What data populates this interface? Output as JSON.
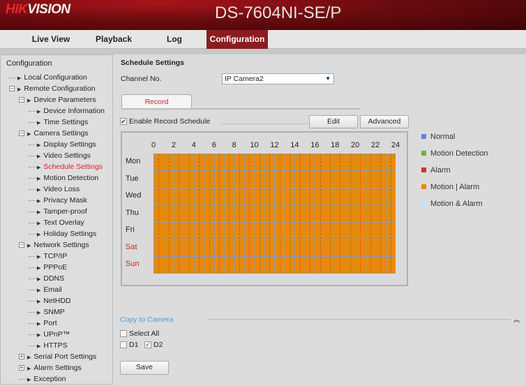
{
  "header": {
    "logo": "HIKVISION",
    "model": "DS-7604NI-SE/P"
  },
  "nav": [
    {
      "label": "Live View"
    },
    {
      "label": "Playback"
    },
    {
      "label": "Log"
    },
    {
      "label": "Configuration",
      "active": true
    }
  ],
  "sidebar": {
    "title": "Configuration",
    "items": [
      {
        "label": "Local Configuration",
        "level": 0
      },
      {
        "label": "Remote Configuration",
        "level": 0,
        "expanded": true
      },
      {
        "label": "Device Parameters",
        "level": 1,
        "expanded": true
      },
      {
        "label": "Device Information",
        "level": 2
      },
      {
        "label": "Time Settings",
        "level": 2
      },
      {
        "label": "Camera Settings",
        "level": 1,
        "expanded": true
      },
      {
        "label": "Display Settings",
        "level": 2
      },
      {
        "label": "Video Settings",
        "level": 2
      },
      {
        "label": "Schedule Settings",
        "level": 2,
        "selected": true
      },
      {
        "label": "Motion Detection",
        "level": 2
      },
      {
        "label": "Video Loss",
        "level": 2
      },
      {
        "label": "Privacy Mask",
        "level": 2
      },
      {
        "label": "Tamper-proof",
        "level": 2
      },
      {
        "label": "Text Overlay",
        "level": 2
      },
      {
        "label": "Holiday Settings",
        "level": 2
      },
      {
        "label": "Network Settings",
        "level": 1,
        "expanded": true
      },
      {
        "label": "TCP/IP",
        "level": 2
      },
      {
        "label": "PPPoE",
        "level": 2
      },
      {
        "label": "DDNS",
        "level": 2
      },
      {
        "label": "Email",
        "level": 2
      },
      {
        "label": "NetHDD",
        "level": 2
      },
      {
        "label": "SNMP",
        "level": 2
      },
      {
        "label": "Port",
        "level": 2
      },
      {
        "label": "UPnP™",
        "level": 2
      },
      {
        "label": "HTTPS",
        "level": 2
      },
      {
        "label": "Serial Port Settings",
        "level": 1,
        "collapsed": true
      },
      {
        "label": "Alarm Settings",
        "level": 1,
        "collapsed": true
      },
      {
        "label": "Exception",
        "level": 1
      }
    ]
  },
  "main": {
    "title": "Schedule Settings",
    "channel_label": "Channel No.",
    "channel_value": "IP Camera2",
    "tab": "Record",
    "enable_label": "Enable Record Schedule",
    "enable_checked": true,
    "edit": "Edit",
    "advanced": "Advanced",
    "hours": [
      "0",
      "2",
      "4",
      "6",
      "8",
      "10",
      "12",
      "14",
      "16",
      "18",
      "20",
      "22",
      "24"
    ],
    "days": [
      {
        "label": "Mon"
      },
      {
        "label": "Tue"
      },
      {
        "label": "Wed"
      },
      {
        "label": "Thu"
      },
      {
        "label": "Fri"
      },
      {
        "label": "Sat",
        "weekend": true
      },
      {
        "label": "Sun",
        "weekend": true
      }
    ],
    "schedule_fill": "Motion | Alarm, all days 00:00-24:00",
    "legend": [
      {
        "label": "Normal",
        "color": "#6a7fe0"
      },
      {
        "label": "Motion Detection",
        "color": "#6ab04c"
      },
      {
        "label": "Alarm",
        "color": "#c0393b"
      },
      {
        "label": "Motion | Alarm",
        "color": "#e8890c"
      },
      {
        "label": "Motion & Alarm",
        "color": "#c8e4f8"
      }
    ],
    "copy_title": "Copy to Camera",
    "select_all": "Select All",
    "cameras": [
      {
        "label": "D1",
        "checked": false
      },
      {
        "label": "D2",
        "checked": true
      }
    ],
    "save": "Save"
  }
}
